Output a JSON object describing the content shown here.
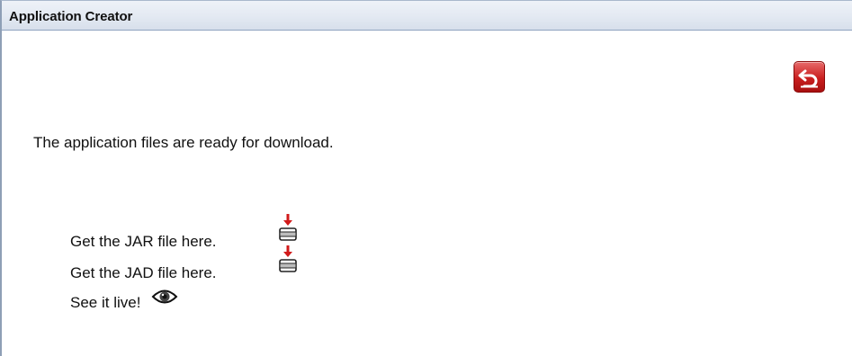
{
  "window": {
    "title": "Application Creator"
  },
  "toolbar": {
    "undo_icon": "undo-arrow-icon",
    "accent": "#c91f1f"
  },
  "main": {
    "message": "The application files are ready for download.",
    "links": [
      {
        "text": "Get the JAR file here.",
        "icon": "download-icon"
      },
      {
        "text": "Get the JAD file here.",
        "icon": "download-icon"
      },
      {
        "text": "See it live!",
        "icon": "eye-icon"
      }
    ]
  }
}
